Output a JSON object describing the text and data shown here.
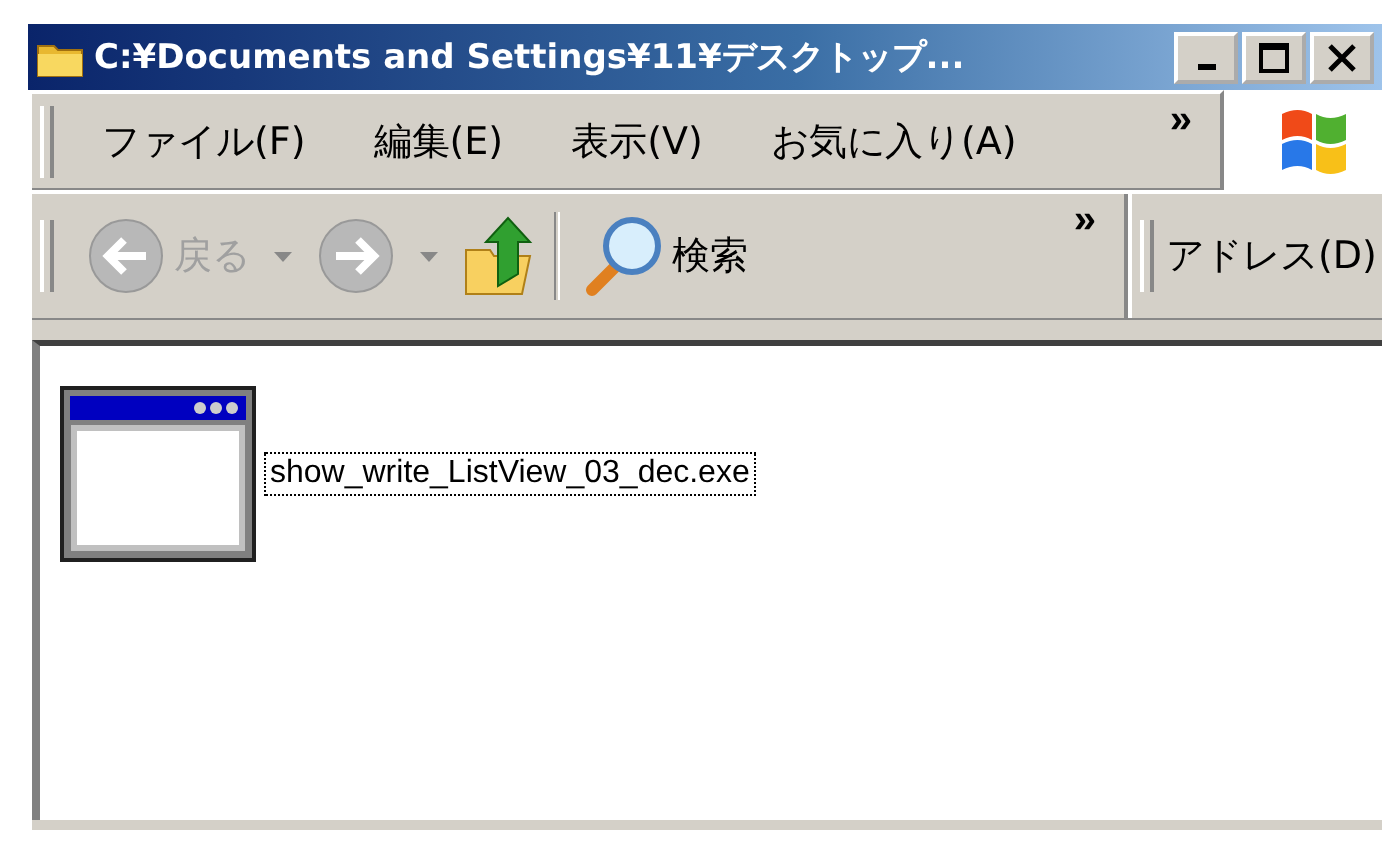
{
  "window": {
    "title": "C:¥Documents and Settings¥11¥デスクトップ..."
  },
  "menu": [
    {
      "label": "ファイル(F)"
    },
    {
      "label": "編集(E)"
    },
    {
      "label": "表示(V)"
    },
    {
      "label": "お気に入り(A)"
    }
  ],
  "menu_overflow": "»",
  "toolbar": {
    "back": {
      "label": "戻る",
      "disabled": true
    },
    "forward": {
      "disabled": true
    },
    "search": {
      "label": "検索"
    },
    "overflow": "»",
    "address_label": "アドレス(D)"
  },
  "files": [
    {
      "name": "show_write_ListView_03_dec.exe",
      "selected": true
    }
  ]
}
